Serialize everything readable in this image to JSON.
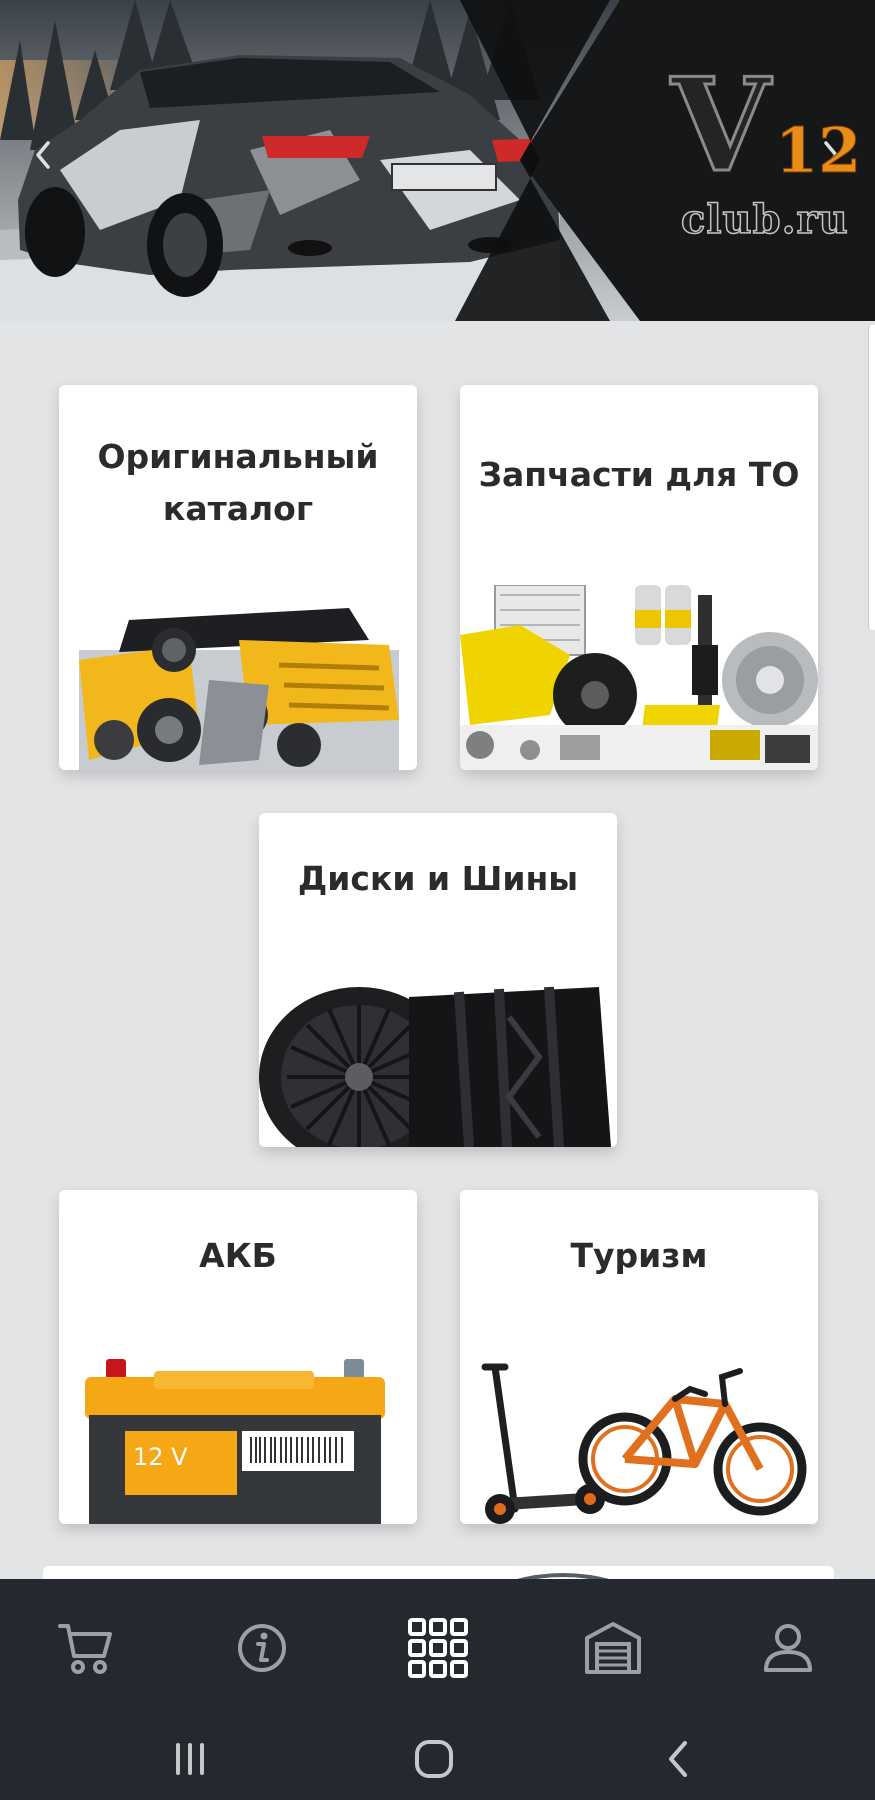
{
  "hero": {
    "logo_letter": "V",
    "logo_number": "12",
    "logo_domain": "club.ru",
    "prev_icon": "chevron-left-icon",
    "next_icon": "chevron-right-icon"
  },
  "categories": [
    {
      "title": "Оригинальный каталог",
      "icon": "engine-image"
    },
    {
      "title": "Запчасти для ТО",
      "icon": "auto-parts-image"
    },
    {
      "title": "Диски и Шины",
      "icon": "tires-image"
    },
    {
      "title": "АКБ",
      "icon": "battery-image",
      "image_text": "12 V"
    },
    {
      "title": "Туризм",
      "icon": "scooter-bike-image"
    }
  ],
  "bottom_nav": [
    {
      "icon": "cart-icon"
    },
    {
      "icon": "info-icon"
    },
    {
      "icon": "grid-icon",
      "active": true
    },
    {
      "icon": "garage-icon"
    },
    {
      "icon": "profile-icon"
    }
  ],
  "system_nav": [
    {
      "icon": "recent-apps-icon"
    },
    {
      "icon": "home-icon"
    },
    {
      "icon": "back-icon"
    }
  ],
  "colors": {
    "page_background": "#e3e4e6",
    "card_background": "#ffffff",
    "nav_background": "#23292e",
    "nav_icon": "#9aa0a5",
    "nav_icon_active": "#ffffff",
    "title_text": "#2b2b2b",
    "logo_accent": "#e88d1a"
  }
}
